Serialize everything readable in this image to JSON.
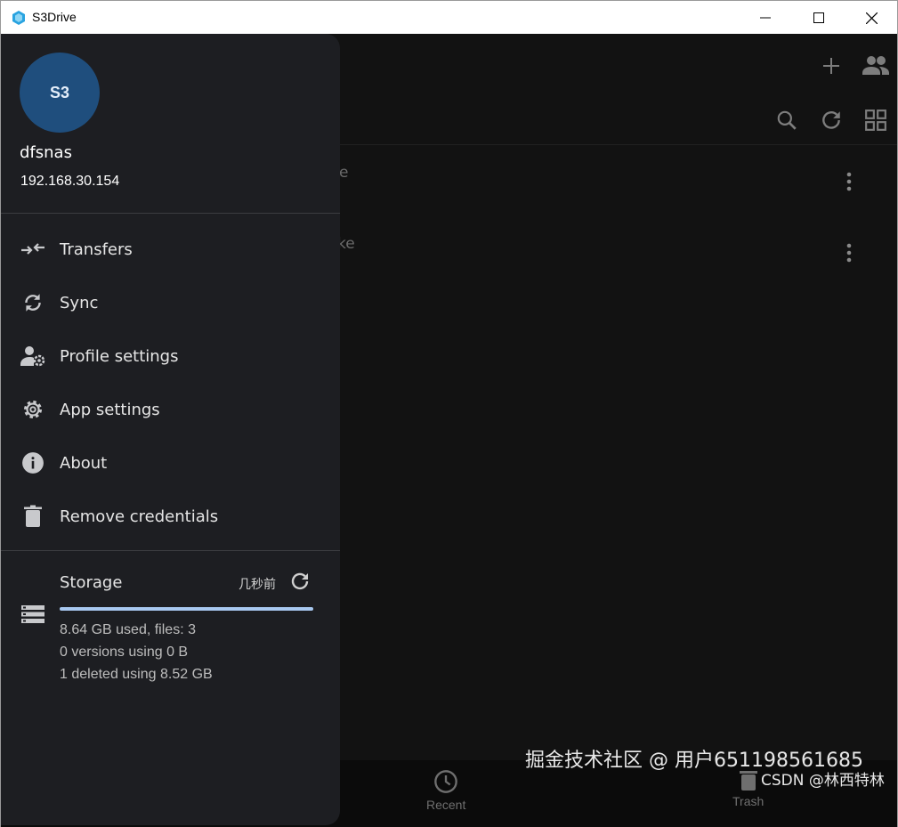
{
  "window": {
    "title": "S3Drive"
  },
  "drawer": {
    "avatar_text": "S3",
    "user_name": "dfsnas",
    "user_ip": "192.168.30.154",
    "menu": [
      {
        "label": "Transfers",
        "icon": "transfers-icon"
      },
      {
        "label": "Sync",
        "icon": "sync-icon"
      },
      {
        "label": "Profile settings",
        "icon": "profile-settings-icon"
      },
      {
        "label": "App settings",
        "icon": "gear-icon"
      },
      {
        "label": "About",
        "icon": "info-icon"
      },
      {
        "label": "Remove credentials",
        "icon": "trash-icon"
      }
    ],
    "storage": {
      "title": "Storage",
      "updated": "几秒前",
      "used_fraction": 1.0,
      "line1": "8.64 GB used, files: 3",
      "line2": "0 versions using 0 B",
      "line3": "1 deleted using 8.52 GB"
    }
  },
  "background": {
    "row1_tail": "e",
    "row2_tail": "ke",
    "bottom_nav": {
      "recent_label": "Recent",
      "trash_label": "Trash"
    }
  },
  "watermark": {
    "line1": "掘金技术社区 @ 用户651198561685",
    "line2": "CSDN @林西特林"
  },
  "colors": {
    "drawer_bg": "#1d1e22",
    "app_bg": "#121212",
    "avatar_bg": "#1f4e7d",
    "storage_fill": "#a8c8f0"
  }
}
